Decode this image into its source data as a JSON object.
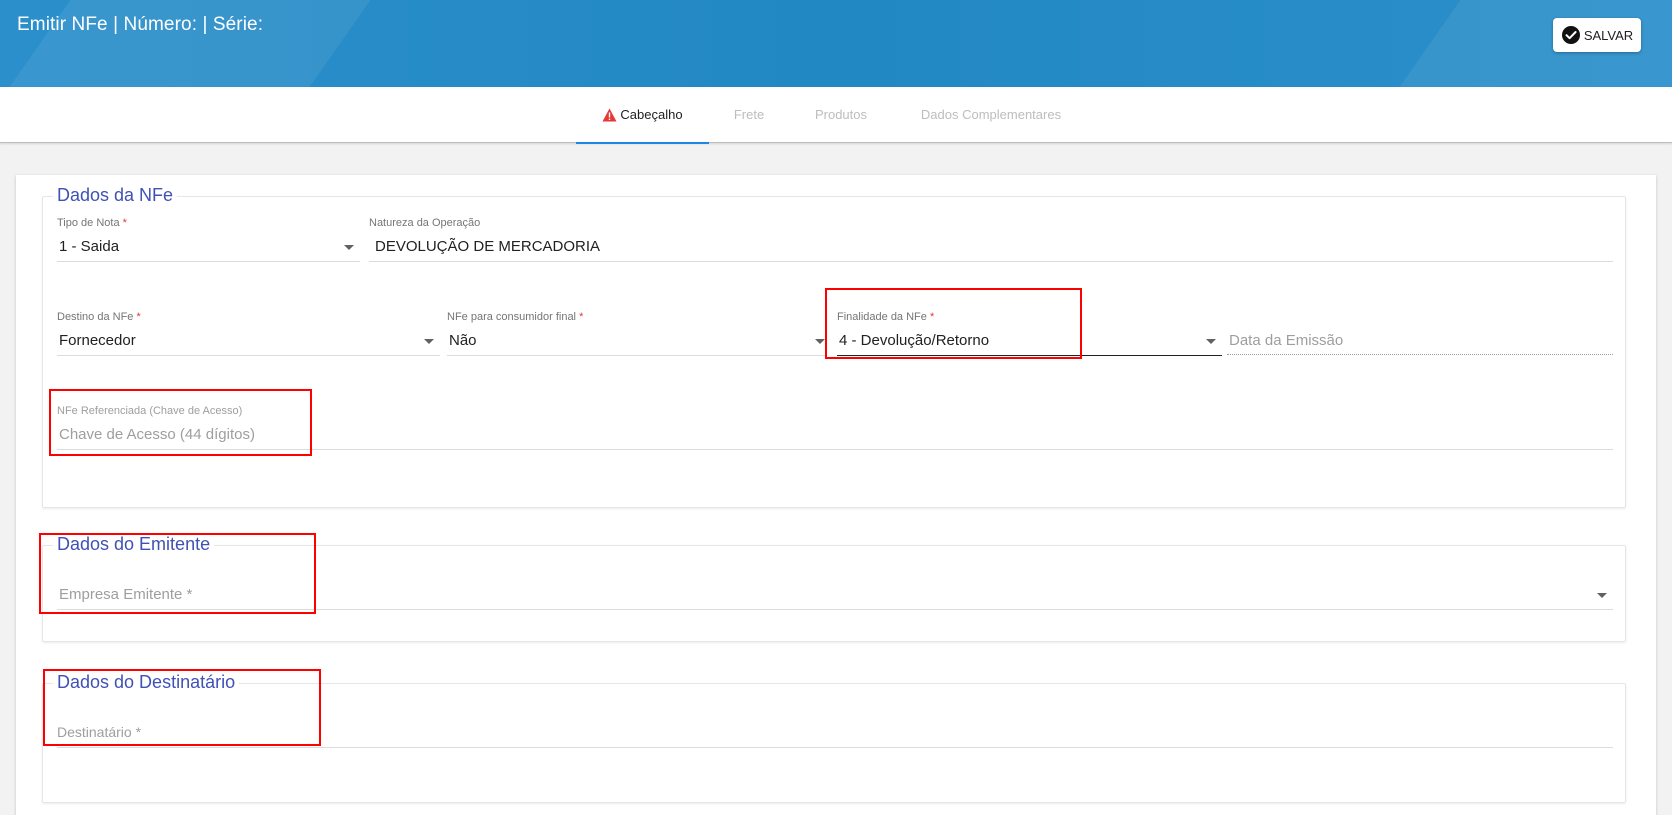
{
  "header": {
    "title": "Emitir NFe | Número: | Série:",
    "save_label": "SALVAR",
    "save_icon": "check-circle-icon"
  },
  "tabs": [
    {
      "label": "Cabeçalho",
      "active": true,
      "icon": "warning-icon"
    },
    {
      "label": "Frete",
      "active": false
    },
    {
      "label": "Produtos",
      "active": false
    },
    {
      "label": "Dados Complementares",
      "active": false
    }
  ],
  "dados_nfe": {
    "legend": "Dados da NFe",
    "tipo_nota": {
      "label": "Tipo de Nota",
      "value": "1 - Saida"
    },
    "natureza_operacao": {
      "label": "Natureza da Operação",
      "value": "DEVOLUÇÃO DE MERCADORIA"
    },
    "destino": {
      "label": "Destino da NFe",
      "value": "Fornecedor"
    },
    "consumidor_final": {
      "label": "NFe para consumidor final",
      "value": "Não"
    },
    "finalidade": {
      "label": "Finalidade da NFe",
      "value": "4 - Devolução/Retorno"
    },
    "data_emissao": {
      "placeholder": "Data da Emissão"
    },
    "nfe_referenciada": {
      "label": "NFe Referenciada (Chave de Acesso)",
      "placeholder": "Chave de Acesso (44 dígitos)"
    }
  },
  "dados_emitente": {
    "legend": "Dados do Emitente",
    "empresa": {
      "placeholder": "Empresa Emitente *"
    }
  },
  "dados_destinatario": {
    "legend": "Dados do Destinatário",
    "destinatario": {
      "placeholder": "Destinatário *"
    }
  },
  "required_mark": "*",
  "colors": {
    "header_bg": "#2288c4",
    "accent": "#1e88e5",
    "legend": "#3f51b5",
    "highlight": "#ff0000",
    "warning": "#e53935"
  }
}
